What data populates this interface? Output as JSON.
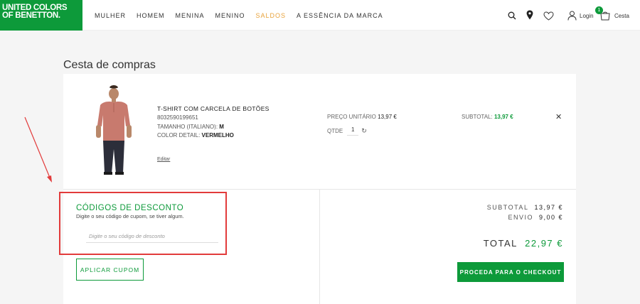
{
  "brand": {
    "line1": "UNITED COLORS",
    "line2": "OF BENETTON."
  },
  "nav": [
    {
      "label": "MULHER",
      "sale": false
    },
    {
      "label": "HOMEM",
      "sale": false
    },
    {
      "label": "MENINA",
      "sale": false
    },
    {
      "label": "MENINO",
      "sale": false
    },
    {
      "label": "SALDOS",
      "sale": true
    },
    {
      "label": "A ESSÊNCIA DA MARCA",
      "sale": false
    }
  ],
  "header_actions": {
    "login": "Login",
    "cart": "Cesta",
    "cart_count": "1"
  },
  "page_title": "Cesta de compras",
  "product": {
    "name": "T-SHIRT COM CARCELA DE BOTÕES",
    "sku": "8032590199651",
    "size_label": "TAMANHO (ITALIANO):",
    "size_value": "M",
    "color_label": "COLOR DETAIL:",
    "color_value": "VERMELHO",
    "edit": "Editar",
    "unit_label": "PREÇO UNITÁRIO",
    "unit_price": "13,97 €",
    "qty_label": "QTDE",
    "qty": "1",
    "subtotal_label": "SUBTOTAL:",
    "subtotal": "13,97 €"
  },
  "discount": {
    "title": "CÓDIGOS DE DESCONTO",
    "subtitle": "Digite o seu código de cupom, se tiver algum.",
    "placeholder": "Digite o seu código de desconto",
    "apply": "APLICAR CUPOM"
  },
  "totals": {
    "subtotal_label": "SUBTOTAL",
    "subtotal": "13,97 €",
    "shipping_label": "ENVIO",
    "shipping": "9,00 €",
    "total_label": "TOTAL",
    "total": "22,97 €",
    "checkout": "PROCEDA PARA O CHECKOUT"
  },
  "colors": {
    "brand_green": "#0d9a3a",
    "sale_orange": "#e8a23a",
    "annotation_red": "#e23b3b"
  }
}
